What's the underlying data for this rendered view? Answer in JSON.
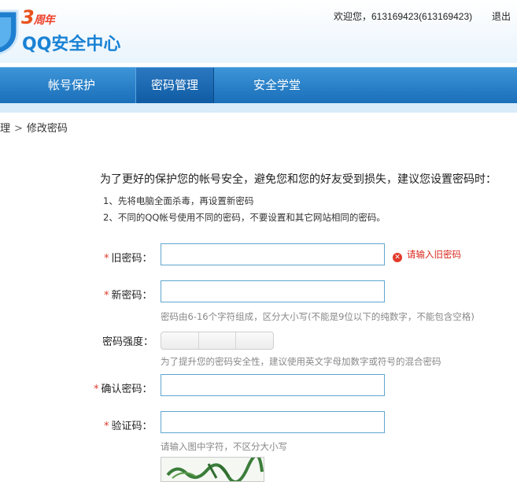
{
  "header": {
    "badge_number": "3",
    "badge_text": "周年",
    "logo_text": "QQ安全中心",
    "welcome": "欢迎您，613169423(613169423)",
    "logout": "退出"
  },
  "nav": {
    "items": [
      {
        "label": "帐号保护",
        "active": false
      },
      {
        "label": "密码管理",
        "active": true
      },
      {
        "label": "安全学堂",
        "active": false
      }
    ]
  },
  "breadcrumb": {
    "parent": "理",
    "current": "修改密码"
  },
  "form": {
    "intro": "为了更好的保护您的帐号安全，避免您和您的好友受到损失，建议您设置密码时：",
    "tips": [
      "1、先将电脑全面杀毒，再设置新密码",
      "2、不同的QQ帐号使用不同的密码，不要设置和其它网站相同的密码。"
    ],
    "required_mark": "*",
    "old_password": {
      "label": "旧密码：",
      "value": "",
      "error": "请输入旧密码"
    },
    "new_password": {
      "label": "新密码：",
      "value": "",
      "hint": "密码由6-16个字符组成，区分大小写(不能是9位以下的纯数字，不能包含空格)"
    },
    "strength": {
      "label": "密码强度：",
      "hint": "为了提升您的密码安全性，建议使用英文字母加数字或符号的混合密码"
    },
    "confirm_password": {
      "label": "确认密码：",
      "value": ""
    },
    "captcha": {
      "label": "验证码：",
      "value": "",
      "hint": "请输入图中字符，不区分大小写"
    }
  },
  "colors": {
    "nav_bg": "#2a80c8",
    "nav_active": "#155fa6",
    "logo_blue": "#1a82d4",
    "required_red": "#e0392b",
    "error_red": "#d8261c",
    "input_border": "#5fa6cf"
  },
  "icons": {
    "shield": "shield-icon",
    "error": "error-x-icon",
    "breadcrumb_sep": "chevron-right-icon"
  }
}
